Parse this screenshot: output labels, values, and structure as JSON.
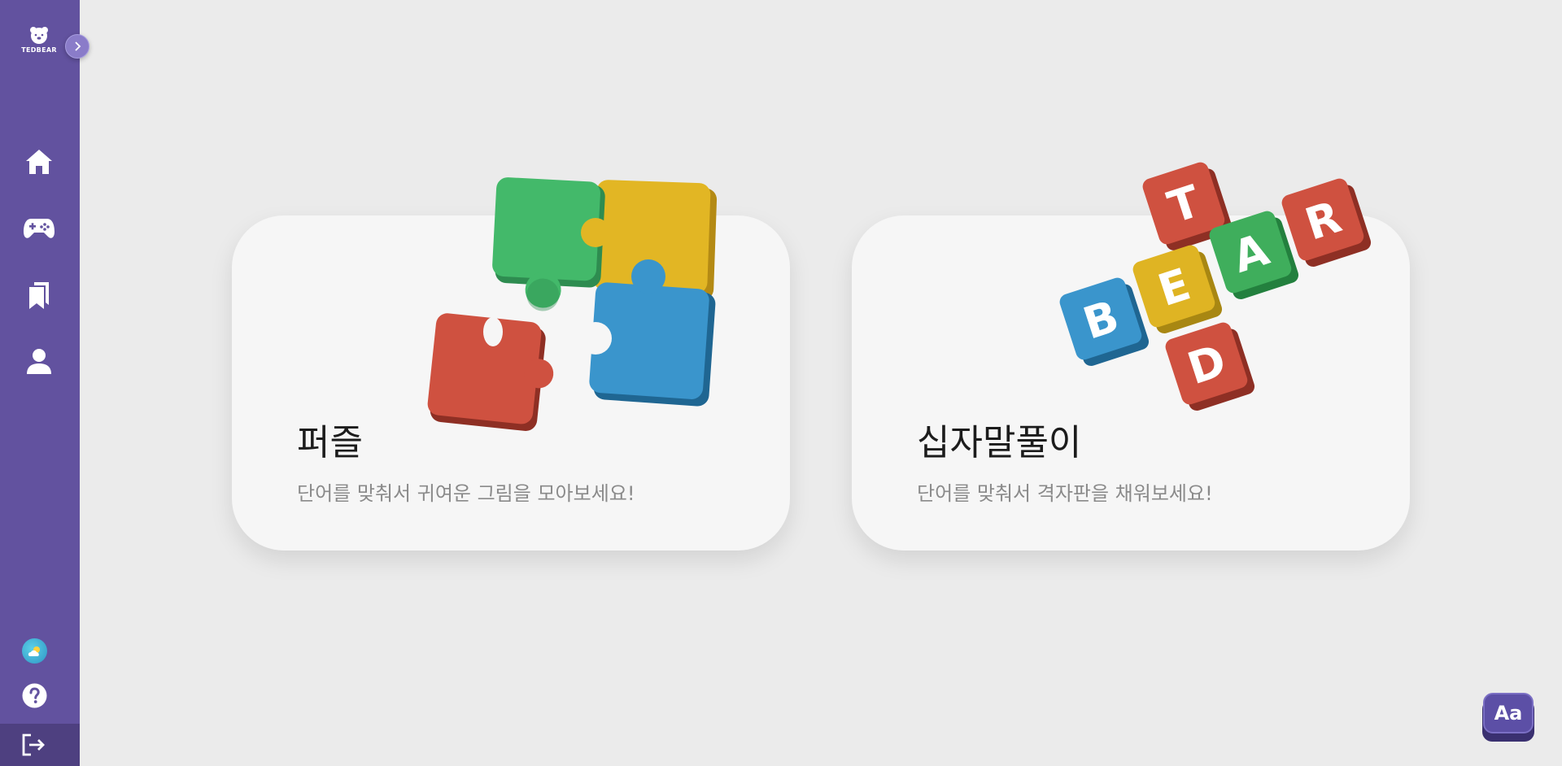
{
  "sidebar": {
    "logo_text": "TEDBEAR",
    "nav": [
      {
        "name": "home",
        "icon": "home-icon"
      },
      {
        "name": "games",
        "icon": "gamepad-icon"
      },
      {
        "name": "bookmarks",
        "icon": "bookmarks-icon"
      },
      {
        "name": "profile",
        "icon": "user-icon"
      }
    ],
    "bottom": [
      "weather-icon",
      "help-icon",
      "logout-icon"
    ]
  },
  "cards": {
    "puzzle": {
      "title": "퍼즐",
      "description": "단어를 맞춰서 귀여운 그림을 모아보세요!"
    },
    "crossword": {
      "title": "십자말풀이",
      "description": "단어를 맞춰서 격자판을 채워보세요!",
      "block_letters": [
        "T",
        "E",
        "A",
        "R",
        "B",
        "D"
      ]
    }
  },
  "font_button": {
    "label": "Aa"
  },
  "colors": {
    "sidebar": "#62529f",
    "background": "#ebebeb",
    "card": "#f6f6f6",
    "green": "#43b96a",
    "yellow": "#e2b624",
    "blue": "#3a95cc",
    "red": "#cf5140"
  }
}
